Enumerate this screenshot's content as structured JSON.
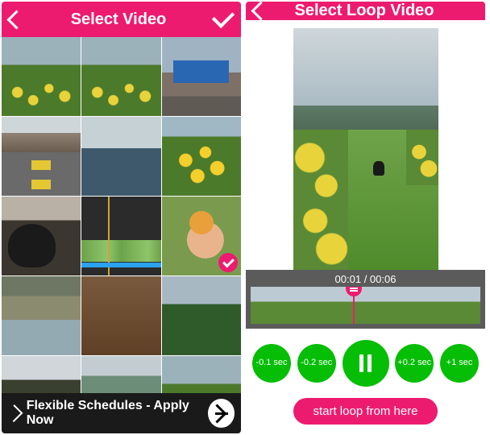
{
  "left": {
    "header": {
      "title": "Select Video"
    },
    "thumbs": [
      {
        "name": "thumb-meadow-1",
        "cls": "t-meadow",
        "selected": false
      },
      {
        "name": "thumb-meadow-2",
        "cls": "t-meadow",
        "selected": false
      },
      {
        "name": "thumb-race",
        "cls": "t-race",
        "selected": false
      },
      {
        "name": "thumb-road",
        "cls": "t-road",
        "selected": false
      },
      {
        "name": "thumb-lake",
        "cls": "t-lake",
        "selected": false
      },
      {
        "name": "thumb-sunflowers",
        "cls": "t-sunfl",
        "selected": false
      },
      {
        "name": "thumb-dog",
        "cls": "t-dog",
        "selected": false
      },
      {
        "name": "thumb-editor",
        "cls": "t-edit",
        "selected": false
      },
      {
        "name": "thumb-hand-flower",
        "cls": "t-hand",
        "selected": true
      },
      {
        "name": "thumb-creek",
        "cls": "t-creek",
        "selected": false
      },
      {
        "name": "thumb-brown",
        "cls": "t-brown",
        "selected": false
      },
      {
        "name": "thumb-trees",
        "cls": "t-trees",
        "selected": false
      },
      {
        "name": "thumb-dark-hill",
        "cls": "t-dark",
        "selected": false
      },
      {
        "name": "thumb-slope",
        "cls": "t-slope",
        "selected": false
      },
      {
        "name": "thumb-meadow-3",
        "cls": "t-meadow",
        "selected": false
      }
    ],
    "ad": {
      "text": "Flexible Schedules - Apply Now"
    }
  },
  "right": {
    "header": {
      "title": "Select Loop Video"
    },
    "time": {
      "display": "00:01 / 00:06",
      "position_pct": 45
    },
    "controls": {
      "back_fast": "-0.1 sec",
      "back_slow": "-0.2 sec",
      "fwd_slow": "+0.2 sec",
      "fwd_fast": "+1 sec"
    },
    "start_loop_label": "start loop from here"
  },
  "colors": {
    "accent": "#ed1b70",
    "control": "#05be05"
  }
}
